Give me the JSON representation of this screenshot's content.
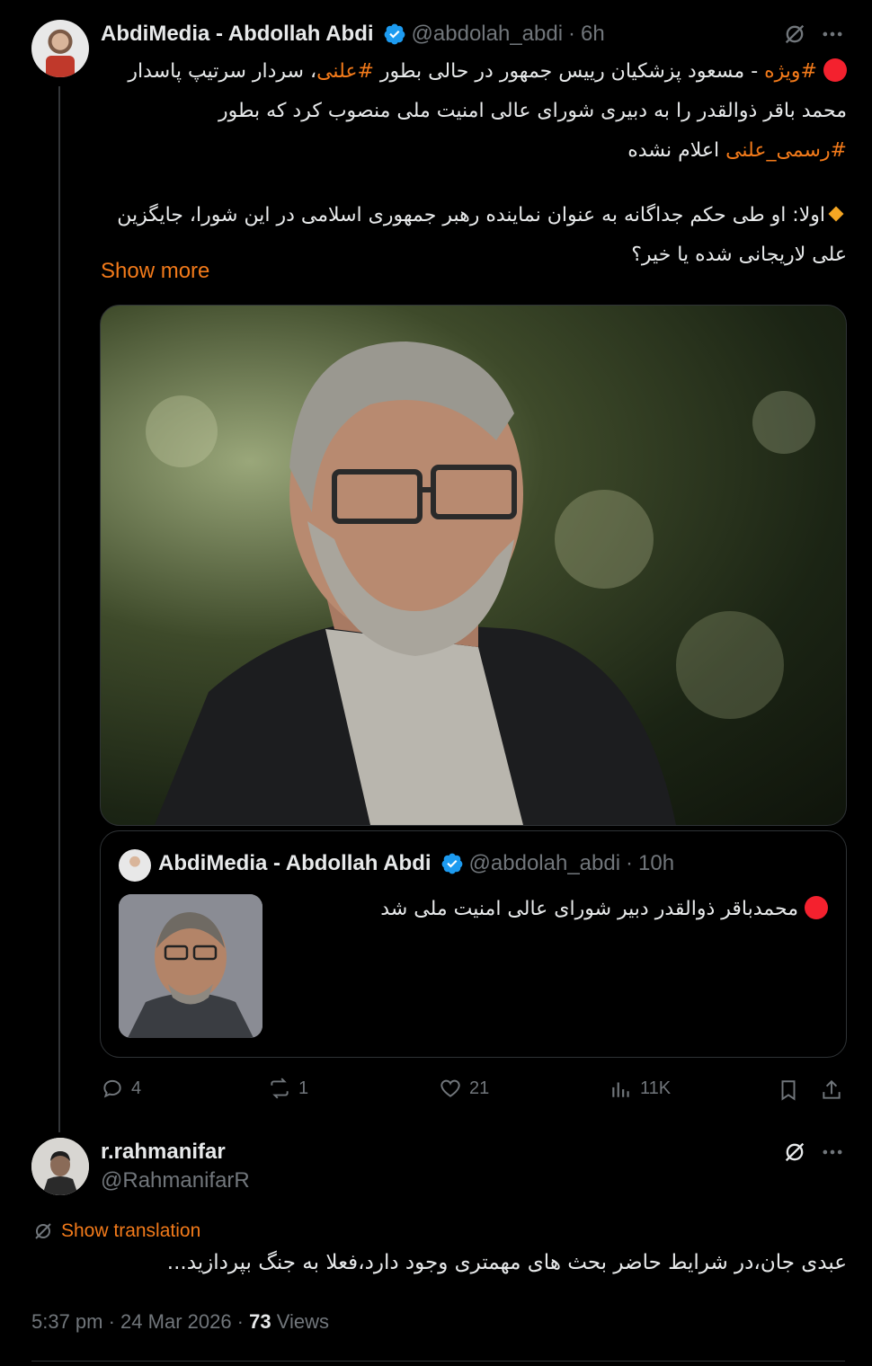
{
  "main_post": {
    "display_name": "AbdiMedia - Abdollah Abdi",
    "handle": "@abdolah_abdi",
    "time_ago": "6h",
    "line1_tag_vizhe": "#ویژه",
    "line1_text_a": " - مسعود پزشکیان رییس جمهور در حالی بطور ",
    "line1_tag_alani": "#علنی",
    "line1_text_b": "، سردار سرتیپ پاسدار",
    "line2": "محمد باقر ذوالقدر را به دبیری شورای عالی امنیت ملی منصوب کرد که بطور",
    "line3_tag": "#رسمی_علنی",
    "line3_text": " اعلام نشده",
    "line4": "اولا: او طی حکم جداگانه به عنوان نماینده رهبر جمهوری اسلامی در این شورا، جایگزین",
    "line5": "علی لاریجانی شده یا خیر؟",
    "show_more": "Show more"
  },
  "quoted_post": {
    "display_name": "AbdiMedia - Abdollah Abdi",
    "handle": "@abdolah_abdi",
    "time_ago": "10h",
    "text": "محمدباقر ذوالقدر دبیر شورای عالی امنیت ملی شد"
  },
  "actions": {
    "replies": "4",
    "reposts": "1",
    "likes": "21",
    "views": "11K"
  },
  "reply_post": {
    "display_name": "r.rahmanifar",
    "handle": "@RahmanifarR",
    "show_translation": "Show translation",
    "text": "عبدی جان،در شرایط حاضر بحث های مهمتری وجود دارد،فعلا به جنگ بپردازید...",
    "timestamp": "5:37 pm · 24 Mar 2026 · ",
    "views_count": "73",
    "views_label": " Views"
  },
  "colors": {
    "accent": "#f27a1a",
    "verified": "#1d9bf0",
    "muted": "#71767b",
    "red": "#f4212e"
  }
}
